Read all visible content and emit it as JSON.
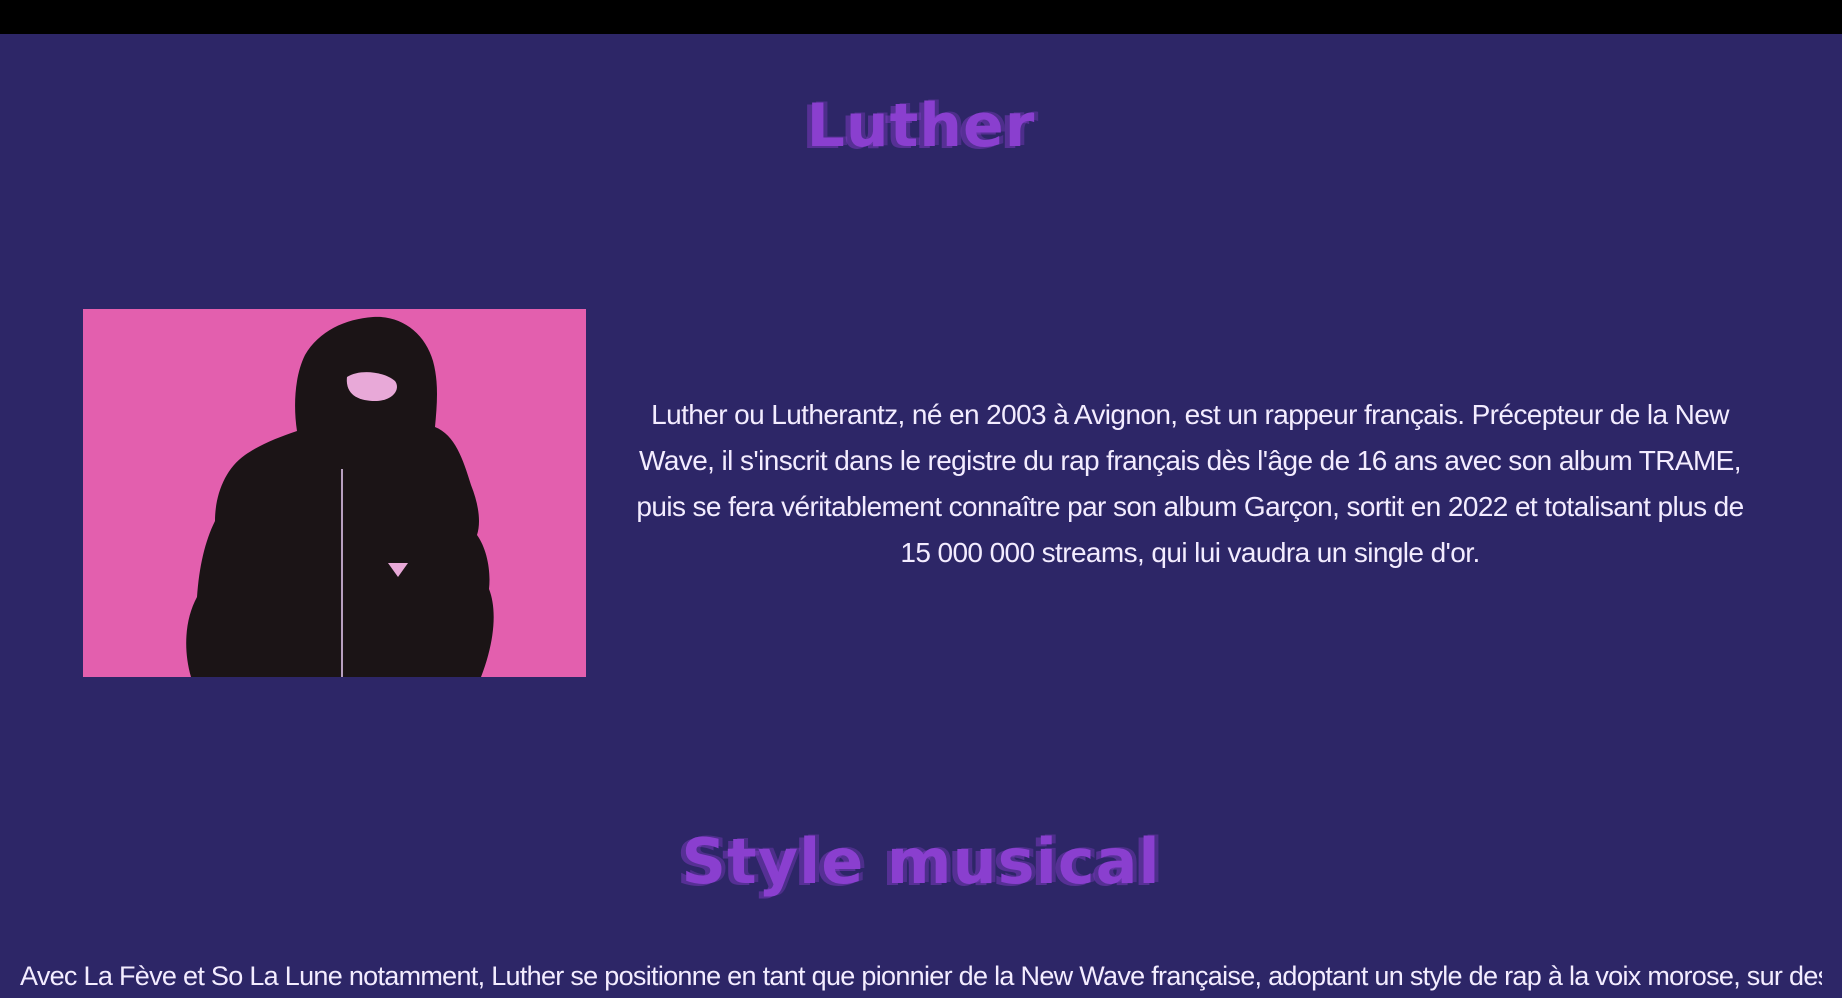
{
  "header": {
    "title": "Luther"
  },
  "artist": {
    "photo_icon": "hooded-figure-photo",
    "bio": "Luther ou Lutherantz, né en 2003 à Avignon, est un rappeur français. Précepteur de la New Wave, il s'inscrit dans le registre du rap français dès l'âge de 16 ans avec son album TRAME, puis se fera véritablement connaître par son album Garçon, sortit en 2022 et totalisant plus de 15 000 000 streams, qui lui vaudra un single d'or."
  },
  "style_section": {
    "title": "Style musical",
    "text": "Avec La Fève et So La Lune notamment, Luther se positionne en tant que pionnier de la New Wave française, adoptant un style de rap à la voix morose, sur des"
  },
  "colors": {
    "background": "#2d2667",
    "topbar": "#000000",
    "heading": "#8a3fcf",
    "text": "#f3ecff",
    "photo_background": "#e35fae"
  }
}
